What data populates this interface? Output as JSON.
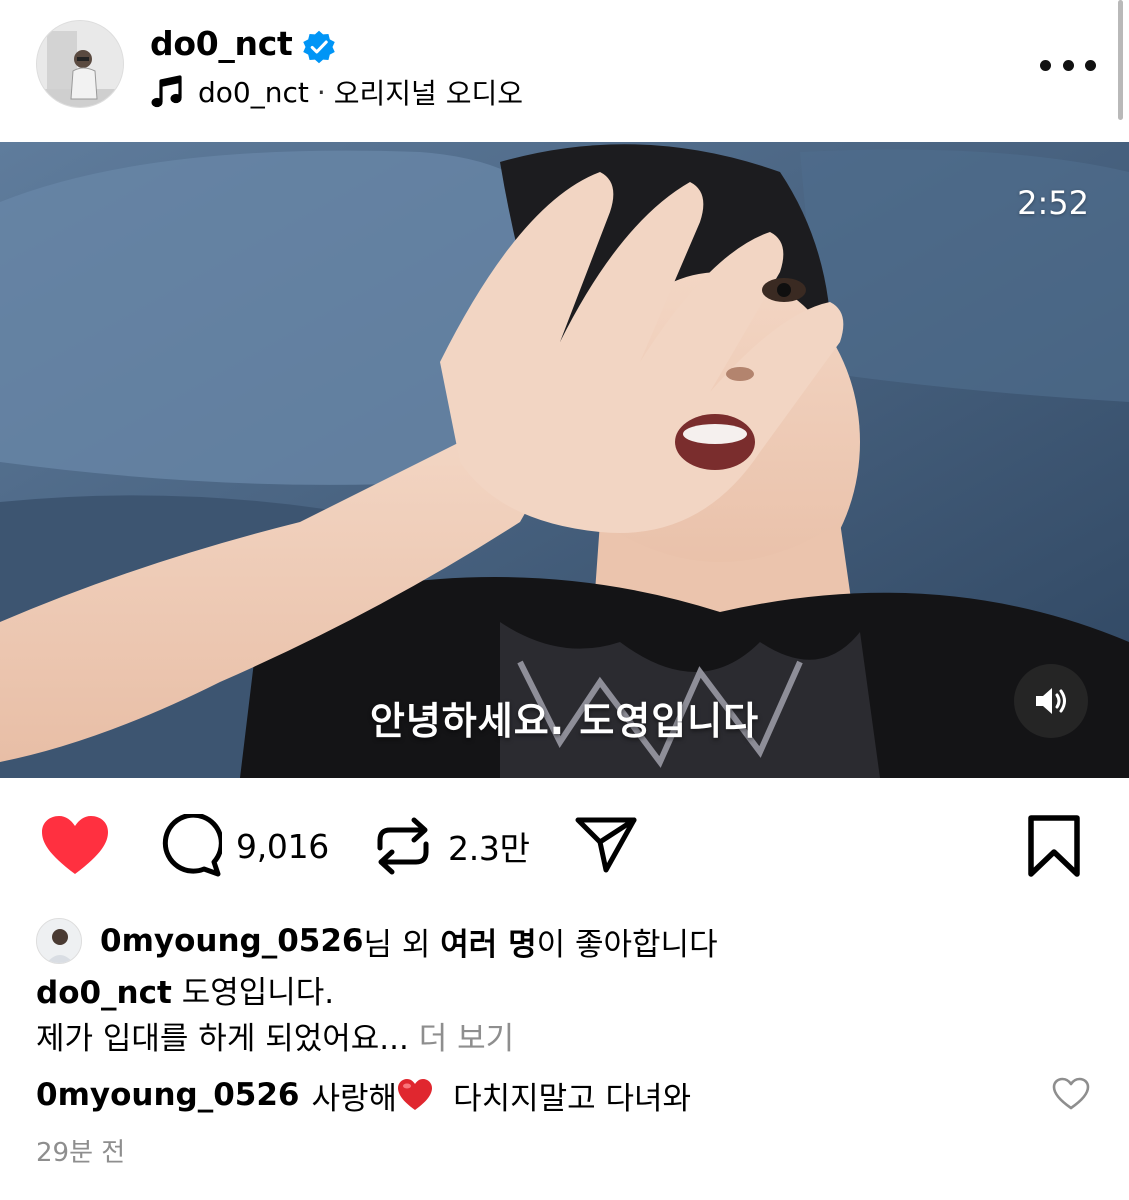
{
  "header": {
    "username": "do0_nct",
    "audio_user": "do0_nct",
    "audio_separator": "·",
    "audio_label": "오리지널 오디오"
  },
  "video": {
    "duration": "2:52",
    "subtitle": "안녕하세요. 도영입니다"
  },
  "actions": {
    "liked": true,
    "comment_count": "9,016",
    "repost_count": "2.3만"
  },
  "likes": {
    "user": "0myoung_0526",
    "text_1": "님 외 ",
    "others": "여러 명",
    "text_2": "이 좋아합니다"
  },
  "caption": {
    "user": "do0_nct",
    "line_1": "도영입니다.",
    "line_2": "제가 입대를 하게 되었어요...",
    "more": "더 보기"
  },
  "comment": {
    "user": "0myoung_0526",
    "text_before": "사랑해",
    "text_after": "다치지말고 다녀와"
  },
  "timestamp": "29분 전",
  "colors": {
    "like_red": "#ff3040",
    "verified_blue": "#0095f6",
    "muted_text": "#8e8e8e"
  },
  "icons": [
    "music-icon",
    "verified-badge-icon",
    "more-options-icon",
    "volume-icon",
    "heart-icon",
    "comment-icon",
    "repost-icon",
    "share-icon",
    "bookmark-icon",
    "heart-emoji-icon",
    "comment-like-icon"
  ]
}
